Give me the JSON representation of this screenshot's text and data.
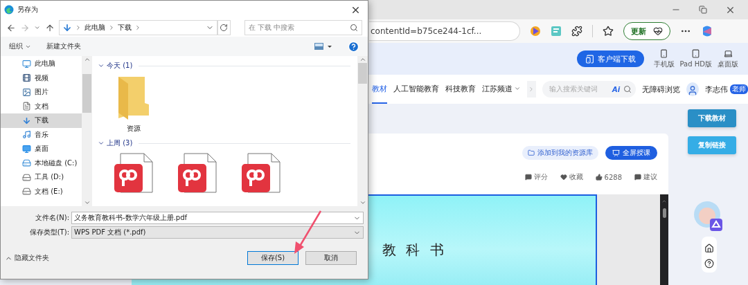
{
  "browser": {
    "address": "contentId=b75ce244-1cf...",
    "update_button": "更新"
  },
  "site": {
    "client_button": "客户端下载",
    "versions": [
      {
        "kind": "phone",
        "label": "手机版"
      },
      {
        "kind": "tablet",
        "label": "Pad HD版"
      },
      {
        "kind": "laptop",
        "label": "桌面版"
      }
    ],
    "nav": [
      {
        "label": "教材",
        "selected": true,
        "dropdown": false
      },
      {
        "label": "人工智能教育",
        "selected": false,
        "dropdown": false
      },
      {
        "label": "科技教育",
        "selected": false,
        "dropdown": false
      },
      {
        "label": "江苏频道",
        "selected": false,
        "dropdown": true
      }
    ],
    "search_placeholder": "输入搜索关键词",
    "ai_label": "Ai",
    "accessibility": "无障碍浏览",
    "user": {
      "name": "李志伟",
      "badge": "老师"
    }
  },
  "side_buttons": [
    {
      "kind": "dark",
      "label": "下载教材"
    },
    {
      "kind": "light",
      "label": "复制链接"
    }
  ],
  "card": {
    "add_button": "添加到我的资源库",
    "fullscreen_button": "全屏授课",
    "actions": [
      {
        "kind": "rate",
        "label": "评分"
      },
      {
        "kind": "favorite",
        "label": "收藏"
      },
      {
        "kind": "like",
        "label": "6288"
      },
      {
        "kind": "suggest",
        "label": "建议"
      }
    ],
    "page_title": "教 科 书"
  },
  "dialog": {
    "title": "另存为",
    "path": [
      "此电脑",
      "下载"
    ],
    "search_placeholder": "在 下载 中搜索",
    "organize": "组织",
    "new_folder": "新建文件夹",
    "nav_items": [
      {
        "kind": "computer",
        "label": "此电脑",
        "selected": false
      },
      {
        "kind": "video",
        "label": "视频",
        "selected": false
      },
      {
        "kind": "picture",
        "label": "图片",
        "selected": false
      },
      {
        "kind": "document",
        "label": "文档",
        "selected": false
      },
      {
        "kind": "download",
        "label": "下载",
        "selected": true
      },
      {
        "kind": "music",
        "label": "音乐",
        "selected": false
      },
      {
        "kind": "desktop",
        "label": "桌面",
        "selected": false
      },
      {
        "kind": "disk",
        "label": "本地磁盘 (C:)",
        "selected": false
      },
      {
        "kind": "drive",
        "label": "工具 (D:)",
        "selected": false
      },
      {
        "kind": "drive",
        "label": "文档 (E:)",
        "selected": false
      }
    ],
    "groups": [
      {
        "label": "今天 (1)",
        "items": [
          {
            "kind": "folder",
            "name": "资源"
          }
        ]
      },
      {
        "label": "上周 (3)",
        "items": [
          {
            "kind": "pdf"
          },
          {
            "kind": "pdf"
          },
          {
            "kind": "pdf"
          }
        ]
      }
    ],
    "filename_label": "文件名(N):",
    "filename": "义务教育教科书-数学六年级上册.pdf",
    "type_label": "保存类型(T):",
    "type": "WPS PDF 文档 (*.pdf)",
    "hide_folders": "隐藏文件夹",
    "buttons": [
      {
        "label": "保存(S)",
        "selected": true
      },
      {
        "label": "取消",
        "selected": false
      }
    ]
  }
}
